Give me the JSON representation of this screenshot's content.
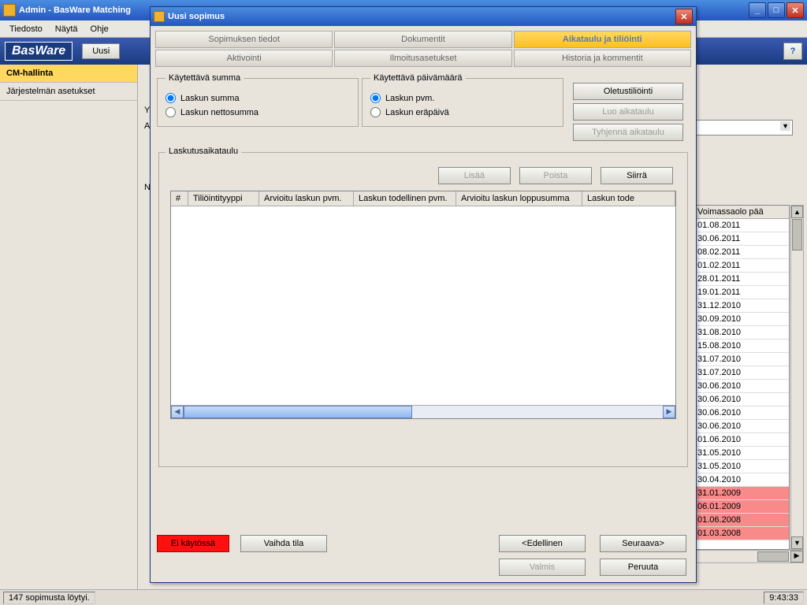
{
  "main_window": {
    "title": "Admin - BasWare Matching",
    "menu": {
      "file": "Tiedosto",
      "view": "Näytä",
      "help": "Ohje"
    },
    "logo": "BasWare",
    "new_btn": "Uusi",
    "help_btn": "?"
  },
  "sidebar": {
    "items": [
      {
        "label": "CM-hallinta",
        "active": true
      },
      {
        "label": "Järjestelmän asetukset",
        "active": false
      }
    ]
  },
  "dialog": {
    "title": "Uusi sopimus",
    "tabs_row1": [
      {
        "label": "Sopimuksen tiedot",
        "active": false
      },
      {
        "label": "Dokumentit",
        "active": false
      },
      {
        "label": "Aikataulu ja tiliöinti",
        "active": true
      }
    ],
    "tabs_row2": [
      {
        "label": "Aktivointi",
        "active": false
      },
      {
        "label": "Ilmoitusasetukset",
        "active": false
      },
      {
        "label": "Historia ja kommentit",
        "active": false
      }
    ],
    "sum_group": {
      "legend": "Käytettävä summa",
      "opt1": "Laskun summa",
      "opt2": "Laskun nettosumma"
    },
    "date_group": {
      "legend": "Käytettävä päivämäärä",
      "opt1": "Laskun pvm.",
      "opt2": "Laskun eräpäivä"
    },
    "buttons": {
      "default_accounting": "Oletustiliöinti",
      "create_schedule": "Luo aikataulu",
      "clear_schedule": "Tyhjennä aikataulu"
    },
    "schedule": {
      "legend": "Laskutusaikataulu",
      "add": "Lisää",
      "delete": "Poista",
      "move": "Siirrä",
      "cols": [
        "#",
        "Tiliöintityyppi",
        "Arvioitu laskun pvm.",
        "Laskun todellinen pvm.",
        "Arvioitu laskun loppusumma",
        "Laskun tode"
      ]
    },
    "bottom": {
      "status": "Ei käytössä",
      "toggle": "Vaihda tila",
      "prev": "<Edellinen",
      "next": "Seuraava>",
      "finish": "Valmis",
      "cancel": "Peruuta"
    }
  },
  "date_list": {
    "header": "Voimassaolo pää",
    "rows": [
      {
        "d": "01.08.2011",
        "red": false
      },
      {
        "d": "30.06.2011",
        "red": false
      },
      {
        "d": "08.02.2011",
        "red": false
      },
      {
        "d": "01.02.2011",
        "red": false
      },
      {
        "d": "28.01.2011",
        "red": false
      },
      {
        "d": "19.01.2011",
        "red": false
      },
      {
        "d": "31.12.2010",
        "red": false
      },
      {
        "d": "30.09.2010",
        "red": false
      },
      {
        "d": "31.08.2010",
        "red": false
      },
      {
        "d": "15.08.2010",
        "red": false
      },
      {
        "d": "31.07.2010",
        "red": false
      },
      {
        "d": "31.07.2010",
        "red": false
      },
      {
        "d": "30.06.2010",
        "red": false
      },
      {
        "d": "30.06.2010",
        "red": false
      },
      {
        "d": "30.06.2010",
        "red": false
      },
      {
        "d": "30.06.2010",
        "red": false
      },
      {
        "d": "01.06.2010",
        "red": false
      },
      {
        "d": "31.05.2010",
        "red": false
      },
      {
        "d": "31.05.2010",
        "red": false
      },
      {
        "d": "30.04.2010",
        "red": false
      },
      {
        "d": "31.01.2009",
        "red": true
      },
      {
        "d": "06.01.2009",
        "red": true
      },
      {
        "d": "01.06.2008",
        "red": true
      },
      {
        "d": "01.03.2008",
        "red": true
      }
    ]
  },
  "statusbar": {
    "left": "147 sopimusta löytyi.",
    "right": "9:43:33"
  },
  "stub_labels": {
    "y": "Y",
    "a": "A",
    "n": "N"
  }
}
